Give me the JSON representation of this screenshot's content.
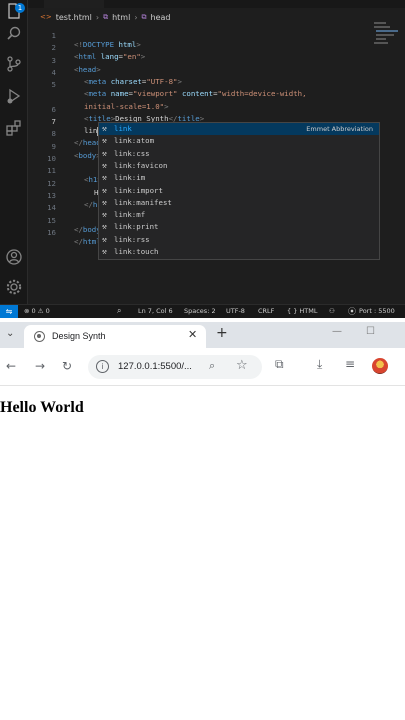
{
  "vscode": {
    "breadcrumb": {
      "file": "test.html",
      "element1": "html",
      "element2": "head"
    },
    "activity_bar": {
      "icons": [
        "files-icon",
        "search-icon",
        "source-control-icon",
        "run-debug-icon",
        "extensions-icon",
        "account-icon",
        "settings-gear-icon"
      ],
      "badge": "1"
    },
    "lines": [
      {
        "n": "1",
        "text": "<!DOCTYPE html>"
      },
      {
        "n": "2",
        "text": "<html lang=\"en\">"
      },
      {
        "n": "3",
        "text": "<head>"
      },
      {
        "n": "4",
        "text": "<meta charset=\"UTF-8\">"
      },
      {
        "n": "5",
        "text": "<meta name=\"viewport\" content=\"width=device-width,"
      },
      {
        "n": "",
        "text": "initial-scale=1.0\">"
      },
      {
        "n": "6",
        "text": "<title>Design Synth</title>"
      },
      {
        "n": "7",
        "text": "lin"
      },
      {
        "n": "8",
        "text": "</head>"
      },
      {
        "n": "9",
        "text": "<body>"
      },
      {
        "n": "10",
        "text": ""
      },
      {
        "n": "11",
        "text": "<h1>"
      },
      {
        "n": "12",
        "text": "H"
      },
      {
        "n": "13",
        "text": "</h1>"
      },
      {
        "n": "14",
        "text": ""
      },
      {
        "n": "15",
        "text": "</body>"
      },
      {
        "n": "16",
        "text": "</html>"
      }
    ],
    "suggestions": {
      "detail": "Emmet Abbreviation",
      "items": [
        "link",
        "link:atom",
        "link:css",
        "link:favicon",
        "link:im",
        "link:import",
        "link:manifest",
        "link:mf",
        "link:print",
        "link:rss",
        "link:touch"
      ]
    },
    "statusbar": {
      "problems": "⊗ 0 ⚠ 0",
      "position": "Ln 7, Col 6",
      "spaces": "Spaces: 2",
      "encoding": "UTF-8",
      "eol": "CRLF",
      "language": "{ } HTML",
      "port": "Port : 5500"
    },
    "colors": {
      "accent": "#0078d4",
      "tag": "#569cd6",
      "attribute": "#9cdcfe",
      "string": "#ce9178"
    }
  },
  "browser": {
    "tab_title": "Design Synth",
    "url": "127.0.0.1:5500/...",
    "page_heading": "Hello World"
  }
}
